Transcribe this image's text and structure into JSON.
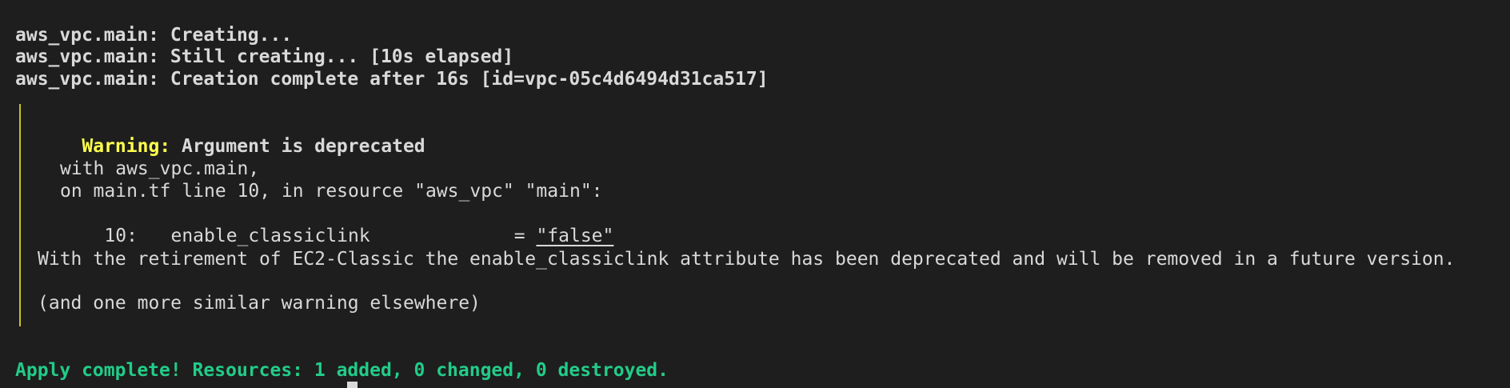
{
  "terminal": {
    "lines": {
      "creating": "aws_vpc.main: Creating...",
      "still_creating": "aws_vpc.main: Still creating... [10s elapsed]",
      "complete": "aws_vpc.main: Creation complete after 16s [id=vpc-05c4d6494d31ca517]"
    },
    "warning": {
      "label": "Warning:",
      "title": " Argument is deprecated",
      "with_line": "with aws_vpc.main,",
      "on_line": "on main.tf line 10, in resource \"aws_vpc\" \"main\":",
      "code_prefix": "10:   enable_classiclink             = ",
      "code_value": "\"false\"",
      "detail": "With the retirement of EC2-Classic the enable_classiclink attribute has been deprecated and will be removed in a future version.",
      "more": "(and one more similar warning elsewhere)"
    },
    "apply_complete": "Apply complete! Resources: 1 added, 0 changed, 0 destroyed."
  },
  "colors": {
    "background": "#1e1e1e",
    "text": "#d9d9d9",
    "warning": "#ffff4d",
    "success": "#22cc88",
    "gutter": "#c8c02a"
  }
}
